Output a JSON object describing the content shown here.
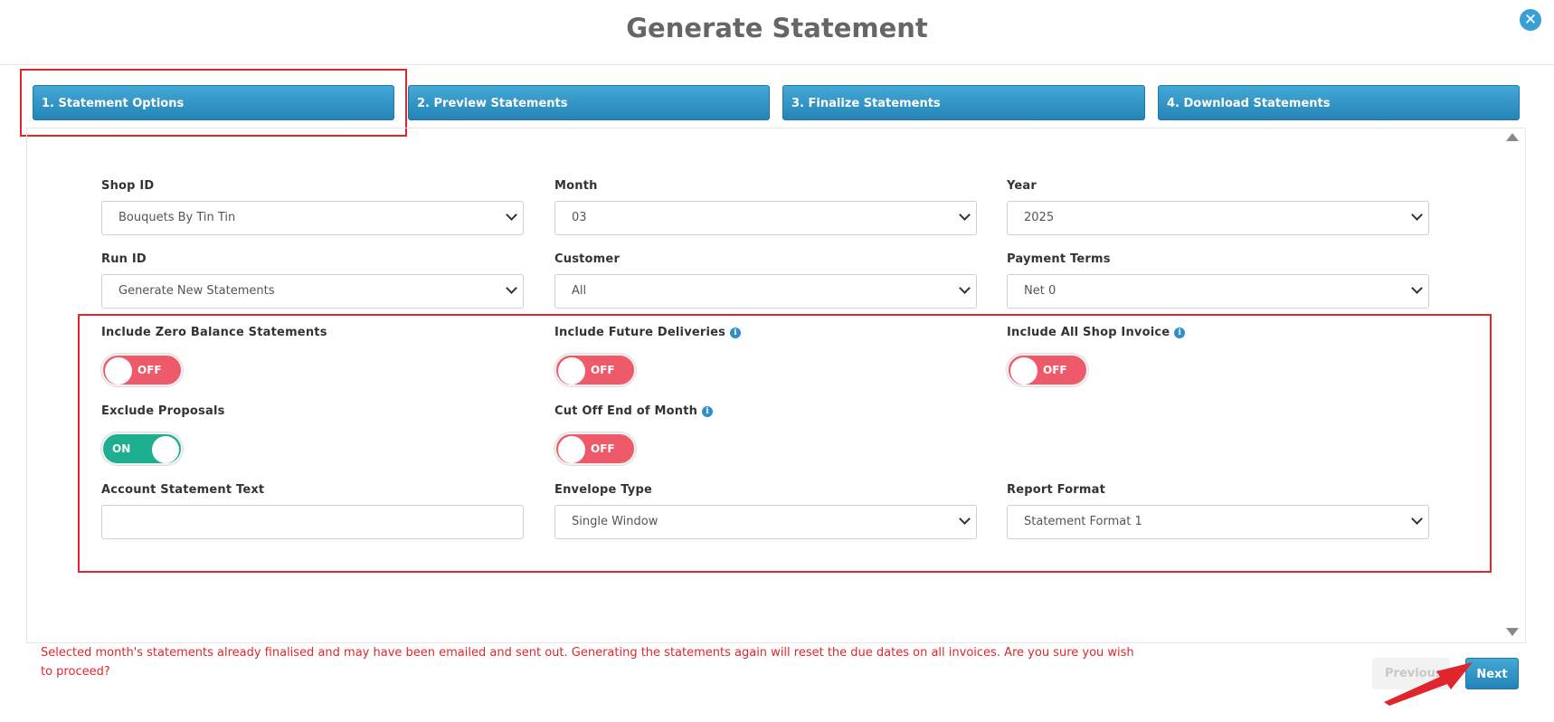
{
  "modal": {
    "title": "Generate Statement",
    "close_icon": "close-icon"
  },
  "steps": [
    {
      "label": "1. Statement Options"
    },
    {
      "label": "2. Preview Statements"
    },
    {
      "label": "3. Finalize Statements"
    },
    {
      "label": "4. Download Statements"
    }
  ],
  "fields": {
    "shop_id": {
      "label": "Shop ID",
      "value": "Bouquets By Tin Tin"
    },
    "month": {
      "label": "Month",
      "value": "03"
    },
    "year": {
      "label": "Year",
      "value": "2025"
    },
    "run_id": {
      "label": "Run ID",
      "value": "Generate New Statements"
    },
    "customer": {
      "label": "Customer",
      "value": "All"
    },
    "payment_terms": {
      "label": "Payment Terms",
      "value": "Net 0"
    },
    "account_statement_text": {
      "label": "Account Statement Text",
      "value": ""
    },
    "envelope_type": {
      "label": "Envelope Type",
      "value": "Single Window"
    },
    "report_format": {
      "label": "Report Format",
      "value": "Statement Format 1"
    }
  },
  "toggles": {
    "include_zero_balance": {
      "label": "Include Zero Balance Statements",
      "state": "OFF"
    },
    "include_future_deliveries": {
      "label": "Include Future Deliveries",
      "state": "OFF"
    },
    "include_all_shop_invoice": {
      "label": "Include All Shop Invoice",
      "state": "OFF"
    },
    "exclude_proposals": {
      "label": "Exclude Proposals",
      "state": "ON"
    },
    "cut_off_end_of_month": {
      "label": "Cut Off End of Month",
      "state": "OFF"
    }
  },
  "info_glyph": "i",
  "warning": "Selected month's statements already finalised and may have been emailed and sent out. Generating the statements again will reset the due dates on all invoices. Are you sure you wish to proceed?",
  "buttons": {
    "previous": "Previous",
    "next": "Next"
  },
  "colors": {
    "accent": "#2f8fc7",
    "toggle_off": "#ef5a6a",
    "toggle_on": "#1eaf91",
    "warning": "#e0262c"
  }
}
